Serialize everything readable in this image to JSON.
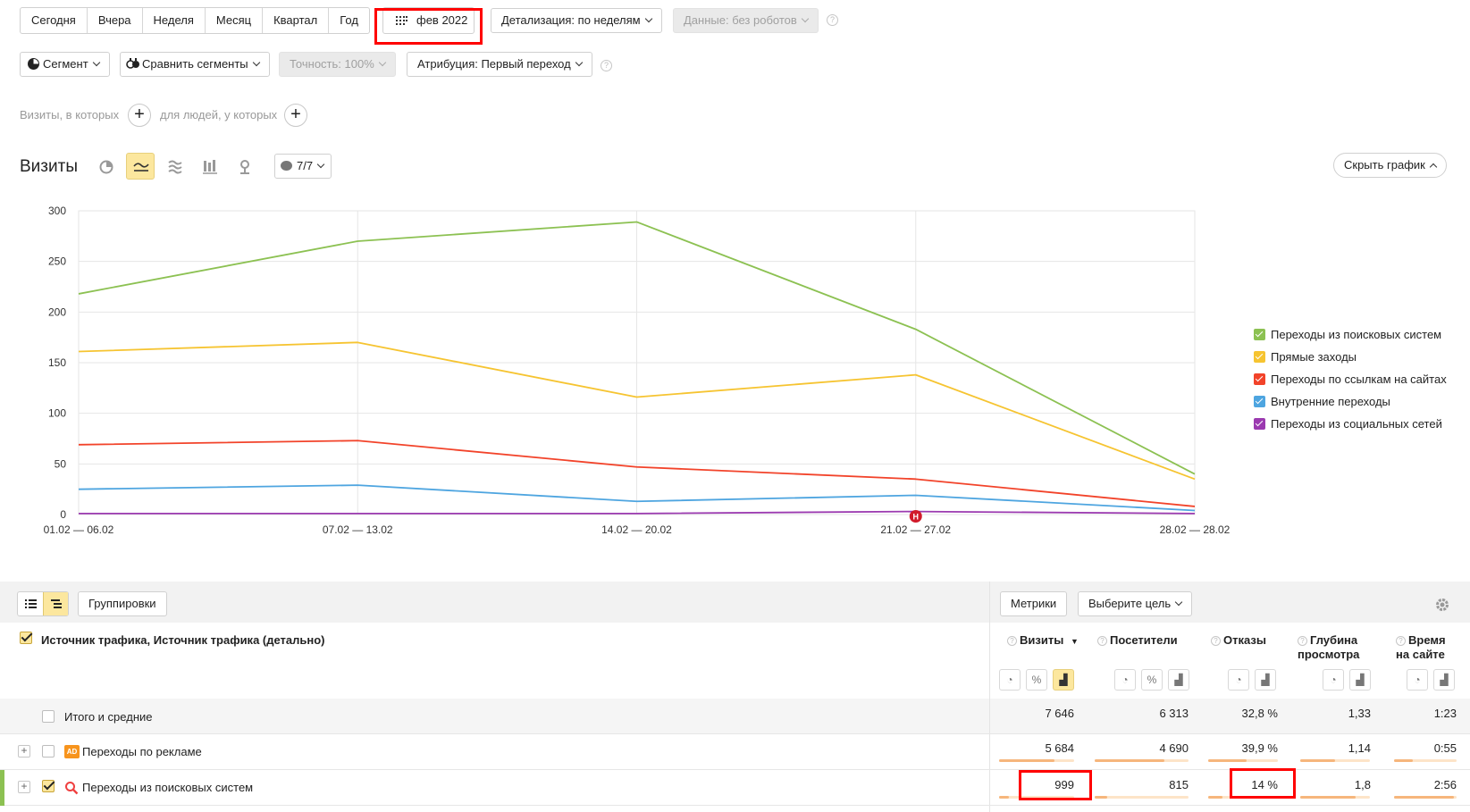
{
  "period_tabs": [
    "Сегодня",
    "Вчера",
    "Неделя",
    "Месяц",
    "Квартал",
    "Год"
  ],
  "date_picker": "фев 2022",
  "detail_label": "Детализация: по неделям",
  "data_filter": "Данные: без роботов",
  "segment_label": "Сегмент",
  "compare_label": "Сравнить сегменты",
  "accuracy_label": "Точность: 100%",
  "attribution_label": "Атрибуция: Первый переход",
  "filters": {
    "visits_where": "Визиты, в которых",
    "people_where": "для людей, у которых"
  },
  "chart_header": {
    "title": "Визиты",
    "series_count": "7/7",
    "hide_button": "Скрыть график"
  },
  "chart_data": {
    "type": "line",
    "x": [
      "01.02 — 06.02",
      "07.02 — 13.02",
      "14.02 — 20.02",
      "21.02 — 27.02",
      "28.02 — 28.02"
    ],
    "yticks": [
      "0",
      "50",
      "100",
      "150",
      "200",
      "250",
      "300"
    ],
    "ylim": [
      0,
      300
    ],
    "grid": true,
    "legend_position": "right",
    "annotation_marker": "Н",
    "series": [
      {
        "name": "Переходы из поисковых систем",
        "color": "#8cc152",
        "values": [
          218,
          270,
          289,
          183,
          40
        ]
      },
      {
        "name": "Прямые заходы",
        "color": "#f6c431",
        "values": [
          161,
          170,
          116,
          138,
          35
        ]
      },
      {
        "name": "Переходы по ссылкам на сайтах",
        "color": "#f2432a",
        "values": [
          69,
          73,
          47,
          35,
          8
        ]
      },
      {
        "name": "Внутренние переходы",
        "color": "#4ea5e0",
        "values": [
          25,
          29,
          13,
          19,
          4
        ]
      },
      {
        "name": "Переходы из социальных сетей",
        "color": "#9b3ab0",
        "values": [
          1,
          1,
          1,
          3,
          1
        ]
      }
    ]
  },
  "table_toolbar": {
    "groupings": "Группировки",
    "metrics": "Метрики",
    "goal": "Выберите цель"
  },
  "table": {
    "dimension_header": "Источник трафика, Источник трафика (детально)",
    "columns": [
      "Визиты",
      "Посетители",
      "Отказы",
      "Глубина просмотра",
      "Время на сайте"
    ],
    "sort_indicator": "▼",
    "rows": [
      {
        "label": "Итого и средние",
        "visits": "7 646",
        "visitors": "6 313",
        "bounce": "32,8 %",
        "depth": "1,33",
        "time": "1:23"
      },
      {
        "label": "Переходы по рекламе",
        "badge": "AD",
        "visits": "5 684",
        "visitors": "4 690",
        "bounce": "39,9 %",
        "depth": "1,14",
        "time": "0:55"
      },
      {
        "label": "Переходы из поисковых систем",
        "visits": "999",
        "visitors": "815",
        "bounce": "14 %",
        "depth": "1,8",
        "time": "2:56"
      }
    ],
    "bar_levels": [
      {
        "visits": 0.74,
        "visitors": 0.74,
        "bounce": 0.55,
        "depth": 0.5,
        "time": 0.3
      },
      {
        "visits": 0.13,
        "visitors": 0.13,
        "bounce": 0.2,
        "depth": 0.8,
        "time": 0.95
      }
    ]
  }
}
